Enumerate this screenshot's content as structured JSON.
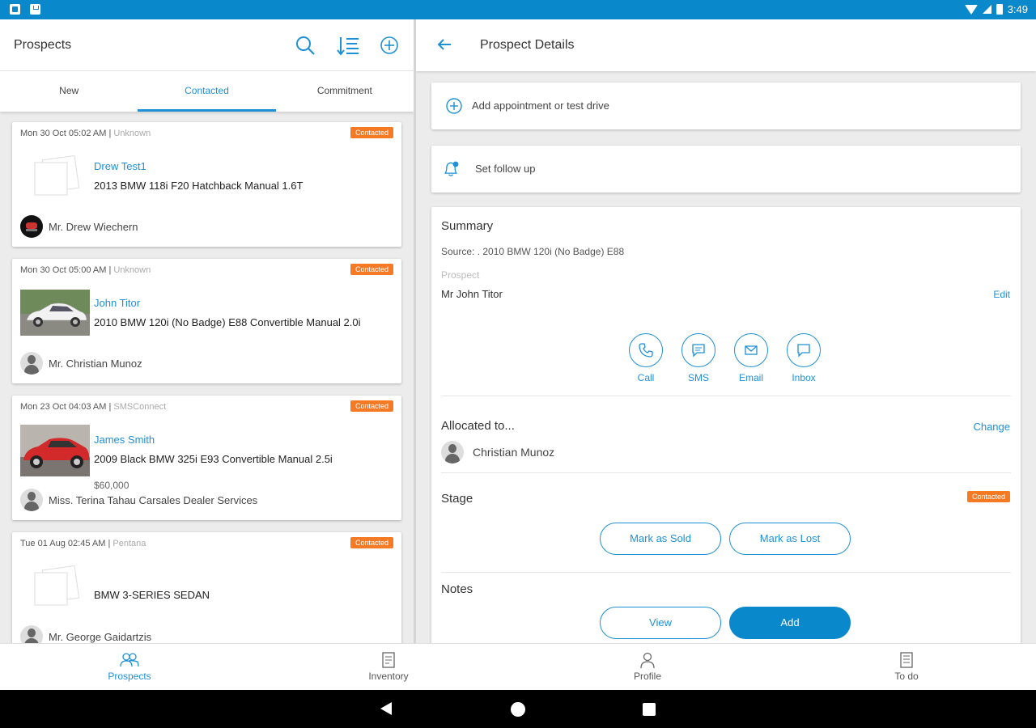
{
  "status_bar": {
    "time": "3:49"
  },
  "left_panel": {
    "title": "Prospects",
    "icons": [
      "search-icon",
      "sort-icon",
      "add-circle-icon"
    ],
    "tabs": [
      {
        "label": "New",
        "active": false
      },
      {
        "label": "Contacted",
        "active": true
      },
      {
        "label": "Commitment",
        "active": false
      }
    ],
    "cards": [
      {
        "date": "Mon 30 Oct 05:02 AM",
        "source": "Unknown",
        "badge": "Contacted",
        "name": "Drew Test1",
        "vehicle": "2013 BMW 118i F20 Hatchback Manual 1.6T",
        "price": "",
        "person": "Mr. Drew Wiechern",
        "thumb": "placeholder"
      },
      {
        "date": "Mon 30 Oct 05:00 AM",
        "source": "Unknown",
        "badge": "Contacted",
        "name": "John Titor",
        "vehicle": "2010 BMW 120i (No Badge) E88 Convertible Manual 2.0i",
        "price": "",
        "person": "Mr. Christian Munoz",
        "thumb": "white-car"
      },
      {
        "date": "Mon 23 Oct 04:03 AM",
        "source": "SMSConnect",
        "badge": "Contacted",
        "name": "James Smith",
        "vehicle": "2009 Black BMW 325i E93 Convertible Manual 2.5i",
        "price": "$60,000",
        "person": "Miss. Terina Tahau Carsales Dealer Services",
        "thumb": "red-car"
      },
      {
        "date": "Tue 01 Aug 02:45 AM",
        "source": "Pentana",
        "badge": "Contacted",
        "name": "",
        "vehicle": "BMW 3-SERIES SEDAN",
        "price": "",
        "person": "Mr. George Gaidartzis",
        "thumb": "placeholder"
      }
    ]
  },
  "right_panel": {
    "title": "Prospect Details",
    "actions": {
      "appointment": "Add appointment or test drive",
      "follow_up": "Set follow up"
    },
    "summary": {
      "heading": "Summary",
      "source": "Source: . 2010 BMW 120i (No Badge) E88",
      "prospect_label": "Prospect",
      "prospect_name": "Mr John Titor",
      "edit": "Edit",
      "contact_buttons": [
        {
          "label": "Call",
          "icon": "phone-icon"
        },
        {
          "label": "SMS",
          "icon": "sms-icon"
        },
        {
          "label": "Email",
          "icon": "email-icon"
        },
        {
          "label": "Inbox",
          "icon": "inbox-icon"
        }
      ],
      "allocated_heading": "Allocated to...",
      "change": "Change",
      "allocated_name": "Christian Munoz",
      "stage_heading": "Stage",
      "stage_badge": "Contacted",
      "mark_sold": "Mark as Sold",
      "mark_lost": "Mark as Lost",
      "notes_heading": "Notes",
      "view": "View",
      "add": "Add"
    }
  },
  "bottom_nav": [
    {
      "label": "Prospects",
      "icon": "people-icon",
      "active": true
    },
    {
      "label": "Inventory",
      "icon": "document-icon",
      "active": false
    },
    {
      "label": "Profile",
      "icon": "person-icon",
      "active": false
    },
    {
      "label": "To do",
      "icon": "checklist-icon",
      "active": false
    }
  ],
  "colors": {
    "accent": "#1f90d6",
    "status_bar": "#0a88cc",
    "badge": "#f57a23"
  }
}
